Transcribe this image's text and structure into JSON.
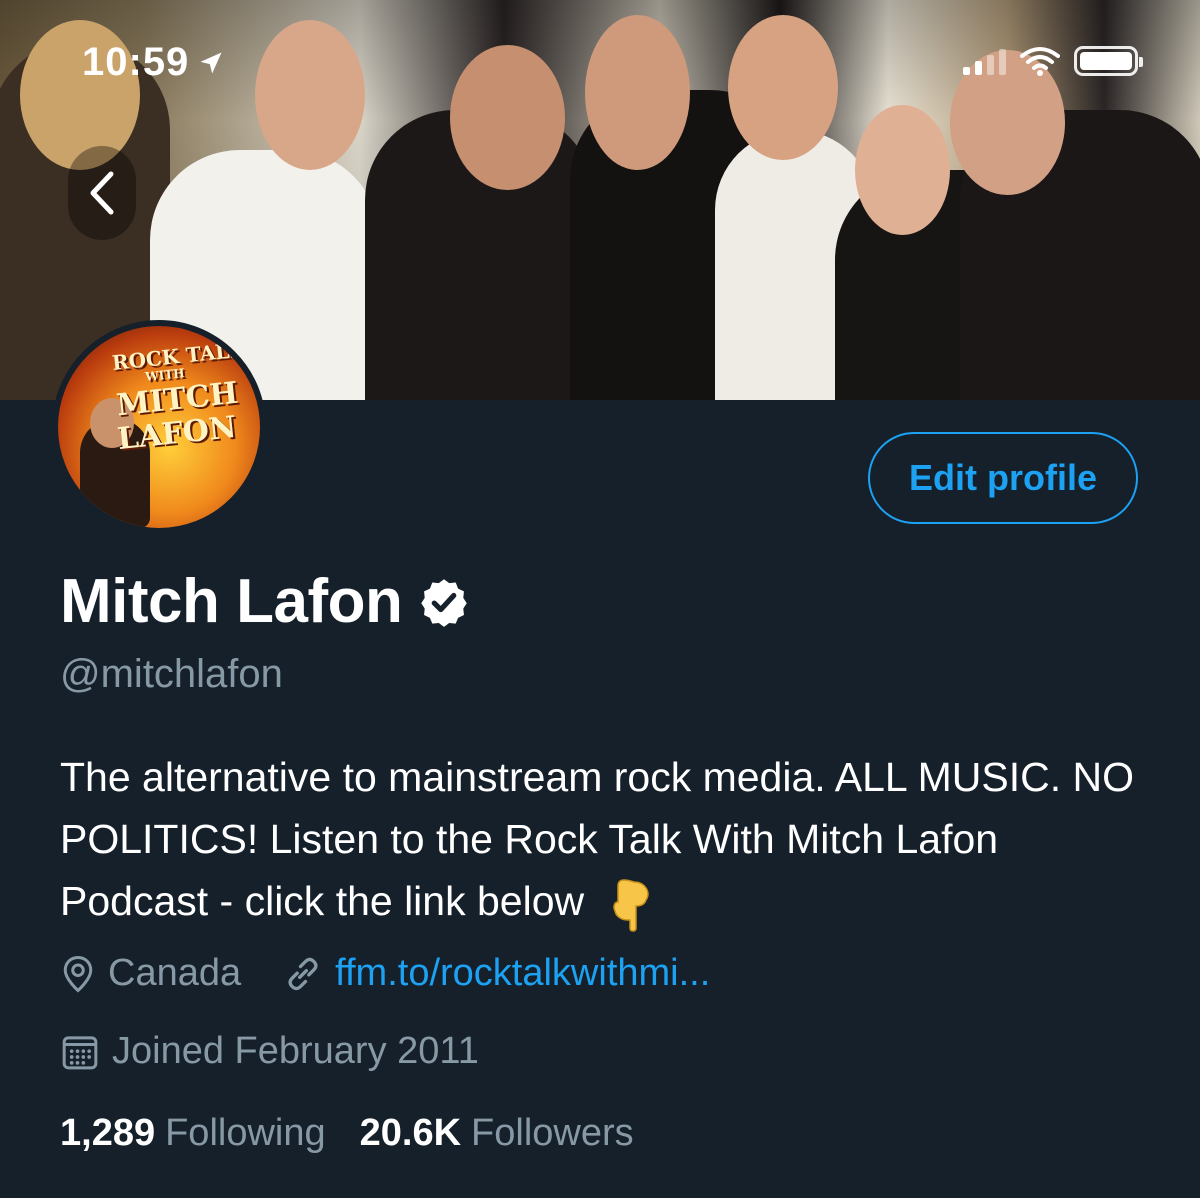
{
  "status_bar": {
    "time": "10:59"
  },
  "header": {
    "banner_description": "Banner photo of a group posing together",
    "back_icon": "chevron-left-icon"
  },
  "avatar": {
    "line1": "ROCK TALK",
    "line2": "WITH",
    "line3": "MITCH",
    "line4": "LAFON"
  },
  "profile": {
    "edit_button_label": "Edit profile",
    "display_name": "Mitch Lafon",
    "verified_icon": "verified-badge-icon",
    "handle": "@mitchlafon",
    "bio": "The alternative to mainstream rock media. ALL MUSIC. NO POLITICS! Listen to the Rock Talk With Mitch Lafon Podcast - click the link below",
    "bio_emoji_icon": "pointing-down-hand-icon",
    "location": "Canada",
    "website": "ffm.to/rocktalkwithmi...",
    "joined": "Joined February 2011",
    "following_count": "1,289",
    "following_label": "Following",
    "followers_count": "20.6K",
    "followers_label": "Followers"
  },
  "colors": {
    "background": "#15202b",
    "accent": "#1da1f2",
    "secondary_text": "#8899a6",
    "primary_text": "#ffffff"
  }
}
